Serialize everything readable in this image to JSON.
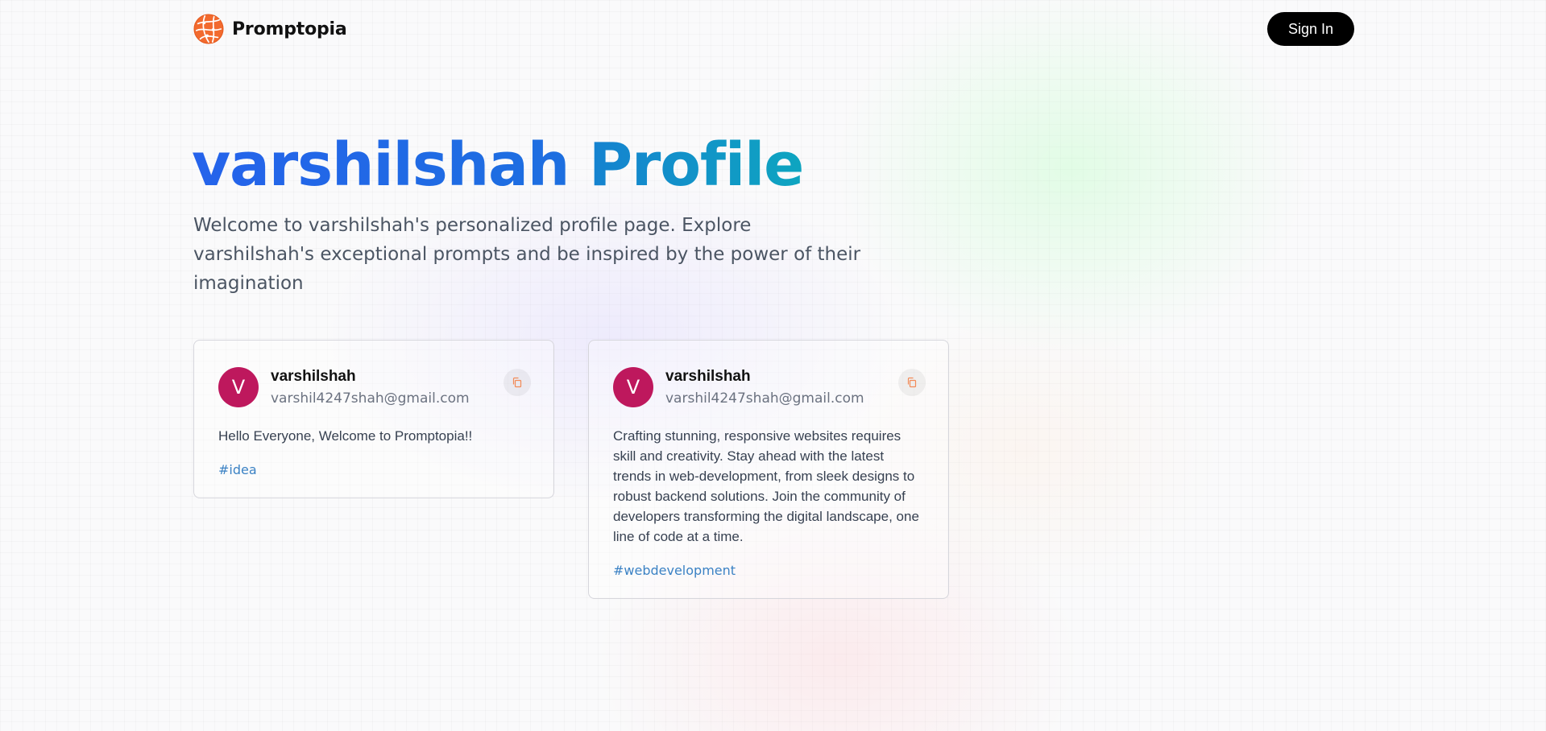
{
  "nav": {
    "brand": "Promptopia",
    "signin_label": "Sign In"
  },
  "hero": {
    "username": "varshilshah",
    "title_suffix": "Profile",
    "description": "Welcome to varshilshah's personalized profile page. Explore varshilshah's exceptional prompts and be inspired by the power of their imagination"
  },
  "prompts": [
    {
      "avatar_letter": "V",
      "username": "varshilshah",
      "email": "varshil4247shah@gmail.com",
      "text": "Hello Everyone, Welcome to Promptopia!!",
      "tag": "#idea"
    },
    {
      "avatar_letter": "V",
      "username": "varshilshah",
      "email": "varshil4247shah@gmail.com",
      "text": "Crafting stunning, responsive websites requires skill and creativity. Stay ahead with the latest trends in web-development, from sleek designs to robust backend solutions. Join the community of developers transforming the digital landscape, one line of code at a time.",
      "tag": "#webdevelopment"
    }
  ],
  "colors": {
    "brand_orange": "#f97316",
    "avatar": "#be185d",
    "title_gradient_start": "#2563eb",
    "title_gradient_end": "#0ea5c9",
    "tag": "#3b82c4"
  },
  "icons": {
    "logo": "globe-network-icon",
    "copy": "copy-icon"
  }
}
